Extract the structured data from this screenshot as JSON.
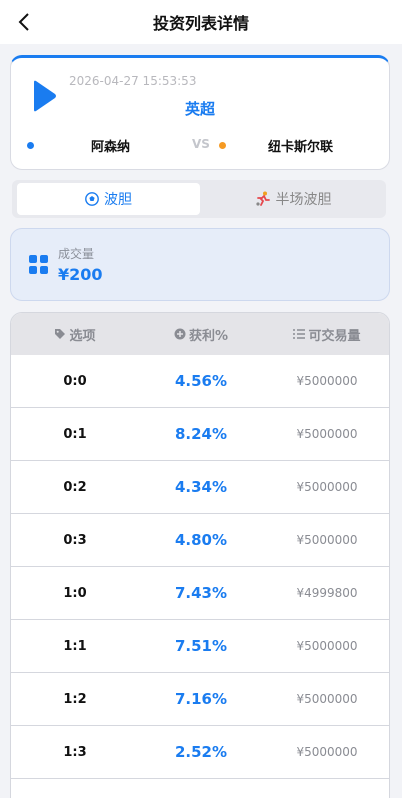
{
  "header": {
    "title": "投资列表详情",
    "back_icon": "chevron-left-icon"
  },
  "match": {
    "time": "2026-04-27 15:53:53",
    "league": "英超",
    "home_team": "阿森纳",
    "vs": "VS",
    "away_team": "纽卡斯尔联",
    "home_color": "#1a7cf0",
    "away_color": "#f59a23"
  },
  "tabs": [
    {
      "label": "波胆",
      "icon": "soccer-ball-icon",
      "active": true
    },
    {
      "label": "半场波胆",
      "icon": "running-player-icon",
      "active": false
    }
  ],
  "volume": {
    "label": "成交量",
    "value": "¥200",
    "icon": "grid-icon"
  },
  "table": {
    "headers": {
      "option": "选项",
      "profit": "获利%",
      "tradable": "可交易量"
    },
    "rows": [
      {
        "score": "0:0",
        "profit": "4.56%",
        "amount": "¥5000000"
      },
      {
        "score": "0:1",
        "profit": "8.24%",
        "amount": "¥5000000"
      },
      {
        "score": "0:2",
        "profit": "4.34%",
        "amount": "¥5000000"
      },
      {
        "score": "0:3",
        "profit": "4.80%",
        "amount": "¥5000000"
      },
      {
        "score": "1:0",
        "profit": "7.43%",
        "amount": "¥4999800"
      },
      {
        "score": "1:1",
        "profit": "7.51%",
        "amount": "¥5000000"
      },
      {
        "score": "1:2",
        "profit": "7.16%",
        "amount": "¥5000000"
      },
      {
        "score": "1:3",
        "profit": "2.52%",
        "amount": "¥5000000"
      }
    ]
  },
  "colors": {
    "accent": "#1a7cf0",
    "background": "#f2f3f7"
  }
}
